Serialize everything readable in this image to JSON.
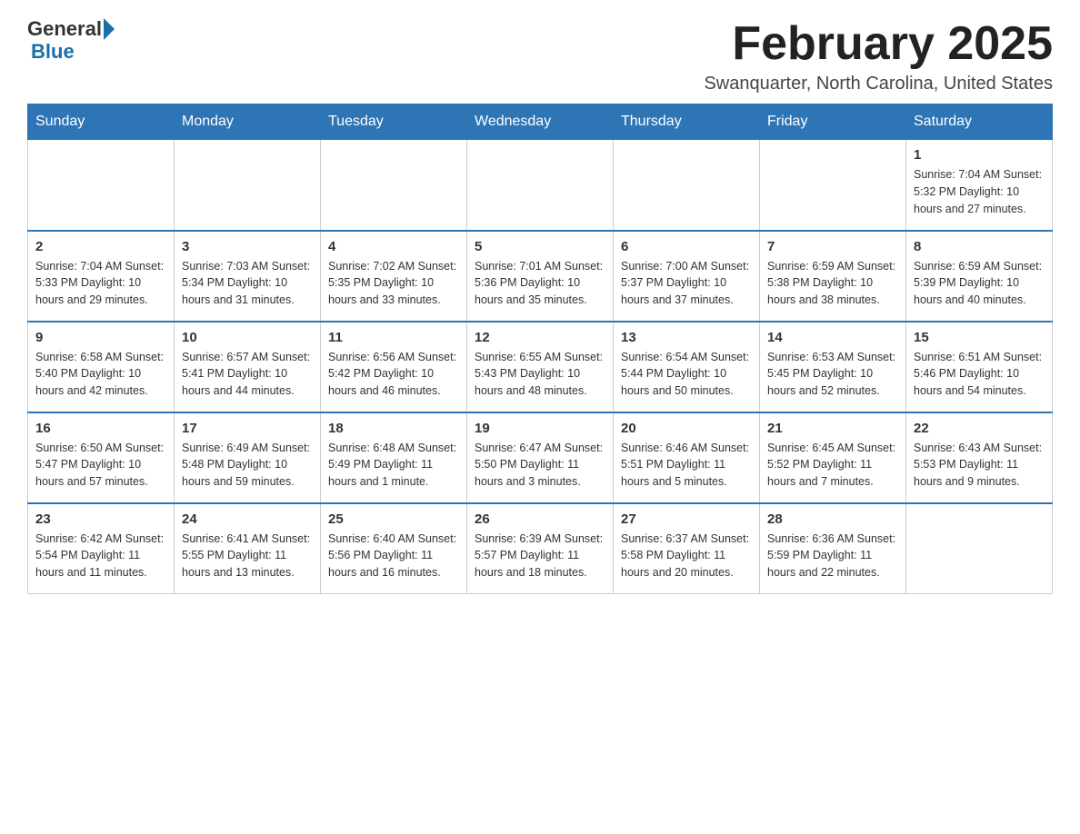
{
  "header": {
    "logo_general": "General",
    "logo_blue": "Blue",
    "month_title": "February 2025",
    "location": "Swanquarter, North Carolina, United States"
  },
  "days_of_week": [
    "Sunday",
    "Monday",
    "Tuesday",
    "Wednesday",
    "Thursday",
    "Friday",
    "Saturday"
  ],
  "weeks": [
    [
      {
        "day": "",
        "info": ""
      },
      {
        "day": "",
        "info": ""
      },
      {
        "day": "",
        "info": ""
      },
      {
        "day": "",
        "info": ""
      },
      {
        "day": "",
        "info": ""
      },
      {
        "day": "",
        "info": ""
      },
      {
        "day": "1",
        "info": "Sunrise: 7:04 AM\nSunset: 5:32 PM\nDaylight: 10 hours and 27 minutes."
      }
    ],
    [
      {
        "day": "2",
        "info": "Sunrise: 7:04 AM\nSunset: 5:33 PM\nDaylight: 10 hours and 29 minutes."
      },
      {
        "day": "3",
        "info": "Sunrise: 7:03 AM\nSunset: 5:34 PM\nDaylight: 10 hours and 31 minutes."
      },
      {
        "day": "4",
        "info": "Sunrise: 7:02 AM\nSunset: 5:35 PM\nDaylight: 10 hours and 33 minutes."
      },
      {
        "day": "5",
        "info": "Sunrise: 7:01 AM\nSunset: 5:36 PM\nDaylight: 10 hours and 35 minutes."
      },
      {
        "day": "6",
        "info": "Sunrise: 7:00 AM\nSunset: 5:37 PM\nDaylight: 10 hours and 37 minutes."
      },
      {
        "day": "7",
        "info": "Sunrise: 6:59 AM\nSunset: 5:38 PM\nDaylight: 10 hours and 38 minutes."
      },
      {
        "day": "8",
        "info": "Sunrise: 6:59 AM\nSunset: 5:39 PM\nDaylight: 10 hours and 40 minutes."
      }
    ],
    [
      {
        "day": "9",
        "info": "Sunrise: 6:58 AM\nSunset: 5:40 PM\nDaylight: 10 hours and 42 minutes."
      },
      {
        "day": "10",
        "info": "Sunrise: 6:57 AM\nSunset: 5:41 PM\nDaylight: 10 hours and 44 minutes."
      },
      {
        "day": "11",
        "info": "Sunrise: 6:56 AM\nSunset: 5:42 PM\nDaylight: 10 hours and 46 minutes."
      },
      {
        "day": "12",
        "info": "Sunrise: 6:55 AM\nSunset: 5:43 PM\nDaylight: 10 hours and 48 minutes."
      },
      {
        "day": "13",
        "info": "Sunrise: 6:54 AM\nSunset: 5:44 PM\nDaylight: 10 hours and 50 minutes."
      },
      {
        "day": "14",
        "info": "Sunrise: 6:53 AM\nSunset: 5:45 PM\nDaylight: 10 hours and 52 minutes."
      },
      {
        "day": "15",
        "info": "Sunrise: 6:51 AM\nSunset: 5:46 PM\nDaylight: 10 hours and 54 minutes."
      }
    ],
    [
      {
        "day": "16",
        "info": "Sunrise: 6:50 AM\nSunset: 5:47 PM\nDaylight: 10 hours and 57 minutes."
      },
      {
        "day": "17",
        "info": "Sunrise: 6:49 AM\nSunset: 5:48 PM\nDaylight: 10 hours and 59 minutes."
      },
      {
        "day": "18",
        "info": "Sunrise: 6:48 AM\nSunset: 5:49 PM\nDaylight: 11 hours and 1 minute."
      },
      {
        "day": "19",
        "info": "Sunrise: 6:47 AM\nSunset: 5:50 PM\nDaylight: 11 hours and 3 minutes."
      },
      {
        "day": "20",
        "info": "Sunrise: 6:46 AM\nSunset: 5:51 PM\nDaylight: 11 hours and 5 minutes."
      },
      {
        "day": "21",
        "info": "Sunrise: 6:45 AM\nSunset: 5:52 PM\nDaylight: 11 hours and 7 minutes."
      },
      {
        "day": "22",
        "info": "Sunrise: 6:43 AM\nSunset: 5:53 PM\nDaylight: 11 hours and 9 minutes."
      }
    ],
    [
      {
        "day": "23",
        "info": "Sunrise: 6:42 AM\nSunset: 5:54 PM\nDaylight: 11 hours and 11 minutes."
      },
      {
        "day": "24",
        "info": "Sunrise: 6:41 AM\nSunset: 5:55 PM\nDaylight: 11 hours and 13 minutes."
      },
      {
        "day": "25",
        "info": "Sunrise: 6:40 AM\nSunset: 5:56 PM\nDaylight: 11 hours and 16 minutes."
      },
      {
        "day": "26",
        "info": "Sunrise: 6:39 AM\nSunset: 5:57 PM\nDaylight: 11 hours and 18 minutes."
      },
      {
        "day": "27",
        "info": "Sunrise: 6:37 AM\nSunset: 5:58 PM\nDaylight: 11 hours and 20 minutes."
      },
      {
        "day": "28",
        "info": "Sunrise: 6:36 AM\nSunset: 5:59 PM\nDaylight: 11 hours and 22 minutes."
      },
      {
        "day": "",
        "info": ""
      }
    ]
  ]
}
